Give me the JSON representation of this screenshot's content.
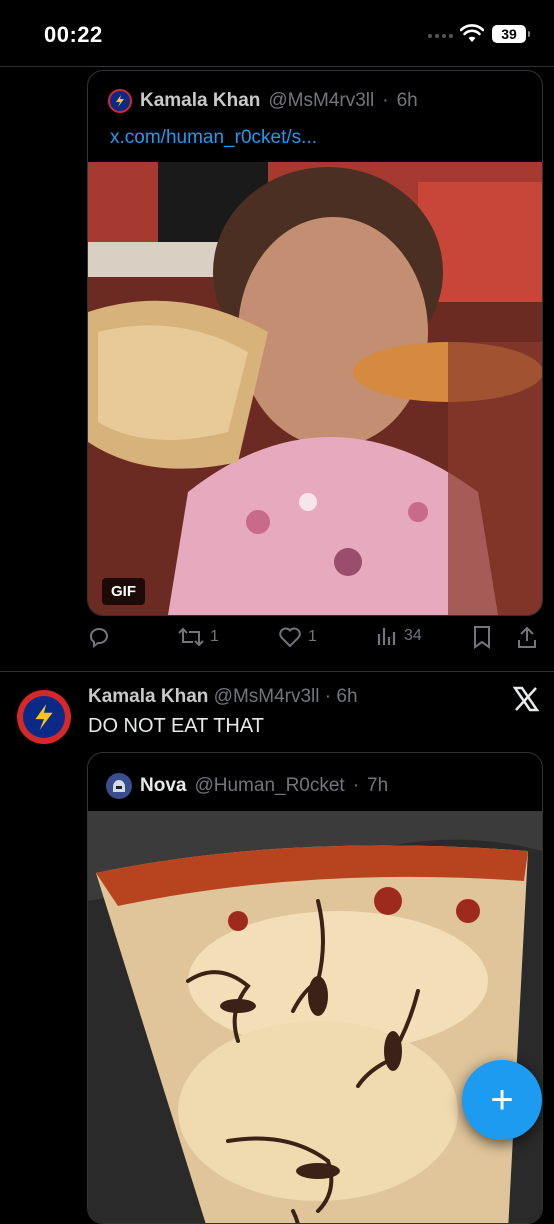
{
  "status_bar": {
    "time": "00:22",
    "battery": "39"
  },
  "quoted_tweet_1": {
    "name": "Kamala Khan",
    "handle": "@MsM4rv3ll",
    "time": "6h",
    "link": "x.com/human_r0cket/s...",
    "media_badge": "GIF"
  },
  "actions": {
    "retweets": "1",
    "likes": "1",
    "views": "34"
  },
  "tweet_2": {
    "name": "Kamala Khan",
    "handle": "@MsM4rv3ll",
    "time": "6h",
    "text": "DO NOT EAT THAT",
    "quote": {
      "name": "Nova",
      "handle": "@Human_R0cket",
      "time": "7h"
    }
  },
  "fab": {
    "label": "+"
  },
  "colors": {
    "accent": "#1d9bf0",
    "background": "#000000",
    "muted": "#71767b",
    "border": "#2f3336"
  }
}
